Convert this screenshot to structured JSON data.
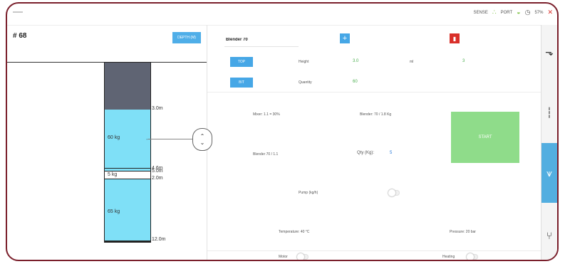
{
  "topbar": {
    "status": [
      {
        "label": "SENSE",
        "icon": "signal-icon",
        "color": "#7dc242"
      },
      {
        "label": "PORT",
        "icon": "network-icon",
        "color": "#7dc242"
      },
      {
        "label": "",
        "icon": "clock-icon",
        "color": "#555555"
      },
      {
        "label": "57%",
        "icon": "battery-icon",
        "color": "#d9302a"
      }
    ]
  },
  "left": {
    "title": "# 68",
    "depth_button": "DEPTH (M)",
    "segments": [
      {
        "label": "",
        "color": "#5f6473"
      },
      {
        "label": "60 kg",
        "color": "#7fe0f7"
      },
      {
        "label": "5 kg",
        "color": "#ffffff"
      },
      {
        "label": "65 kg",
        "color": "#7fe0f7"
      }
    ],
    "ticks": [
      "3.0m",
      "4.6m",
      "5.0m",
      "2.0m",
      "12.0m"
    ]
  },
  "controls": {
    "name_value": "Blender 70",
    "add_icon": "plus-icon",
    "delete_icon": "trash-icon",
    "row1": {
      "tag": "TOP",
      "label1": "Height",
      "value1": "3.0",
      "label2": "ml",
      "value2": "3"
    },
    "row2": {
      "tag": "BIT",
      "label1": "Quantity",
      "value1": "60"
    }
  },
  "blend": {
    "note1": "Mixer: 1.1 = 30%",
    "note2": "Blender: 70 / 1.8 Kg",
    "note3": "Blender 70 / 1.1",
    "qty_label": "Qty (Kg):",
    "qty_value": "5",
    "start_label": "START",
    "pump_label": "Pump (kg/h)",
    "temp_label": "Temperature: 40 °C",
    "pressure_label": "Pressure: 20 bar",
    "motor_label": "Motor",
    "heating_label": "Heating"
  },
  "sidebar": {
    "items": [
      "drill-icon",
      "ruler-icon",
      "funnel-icon",
      "split-icon"
    ],
    "active_index": 2
  }
}
